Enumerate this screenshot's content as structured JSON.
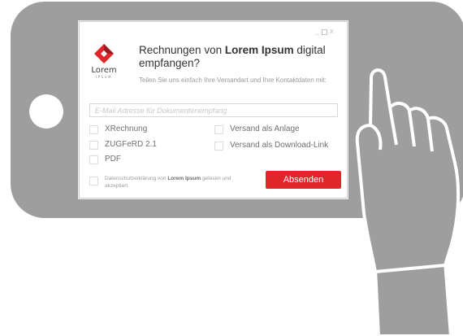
{
  "colors": {
    "phone_body": "#9e9e9e",
    "phone_button": "#ffffff",
    "hand_fill": "#9e9e9e",
    "hand_outline": "#000000",
    "accent": "#e1262b",
    "logo_red": "#e1262b",
    "logo_dark": "#9e1b1e"
  },
  "window_controls": {
    "minimize": "_",
    "close": "x"
  },
  "logo": {
    "name": "Lorem",
    "sub": "IPSUM"
  },
  "headline": {
    "prefix": "Rechnungen von ",
    "brand": "Lorem Ipsum",
    "suffix": " digital empfangen?"
  },
  "intro": "Teilen Sie uns einfach Ihre Versandart und Ihre Kontaktdaten mit:",
  "email": {
    "placeholder": "E-Mail Adresse für Dokumentenempfang",
    "value": ""
  },
  "formats": [
    {
      "label": "XRechnung",
      "checked": false
    },
    {
      "label": "ZUGFeRD 2.1",
      "checked": false
    },
    {
      "label": "PDF",
      "checked": false
    }
  ],
  "delivery": [
    {
      "label": "Versand als Anlage",
      "checked": false
    },
    {
      "label": "Versand als Download-Link",
      "checked": false
    }
  ],
  "privacy": {
    "prefix": "Datenschutzerklärung von ",
    "brand": "Lorem Ipsum",
    "suffix": " gelesen und akzeptiert.",
    "checked": false
  },
  "submit_label": "Absenden"
}
